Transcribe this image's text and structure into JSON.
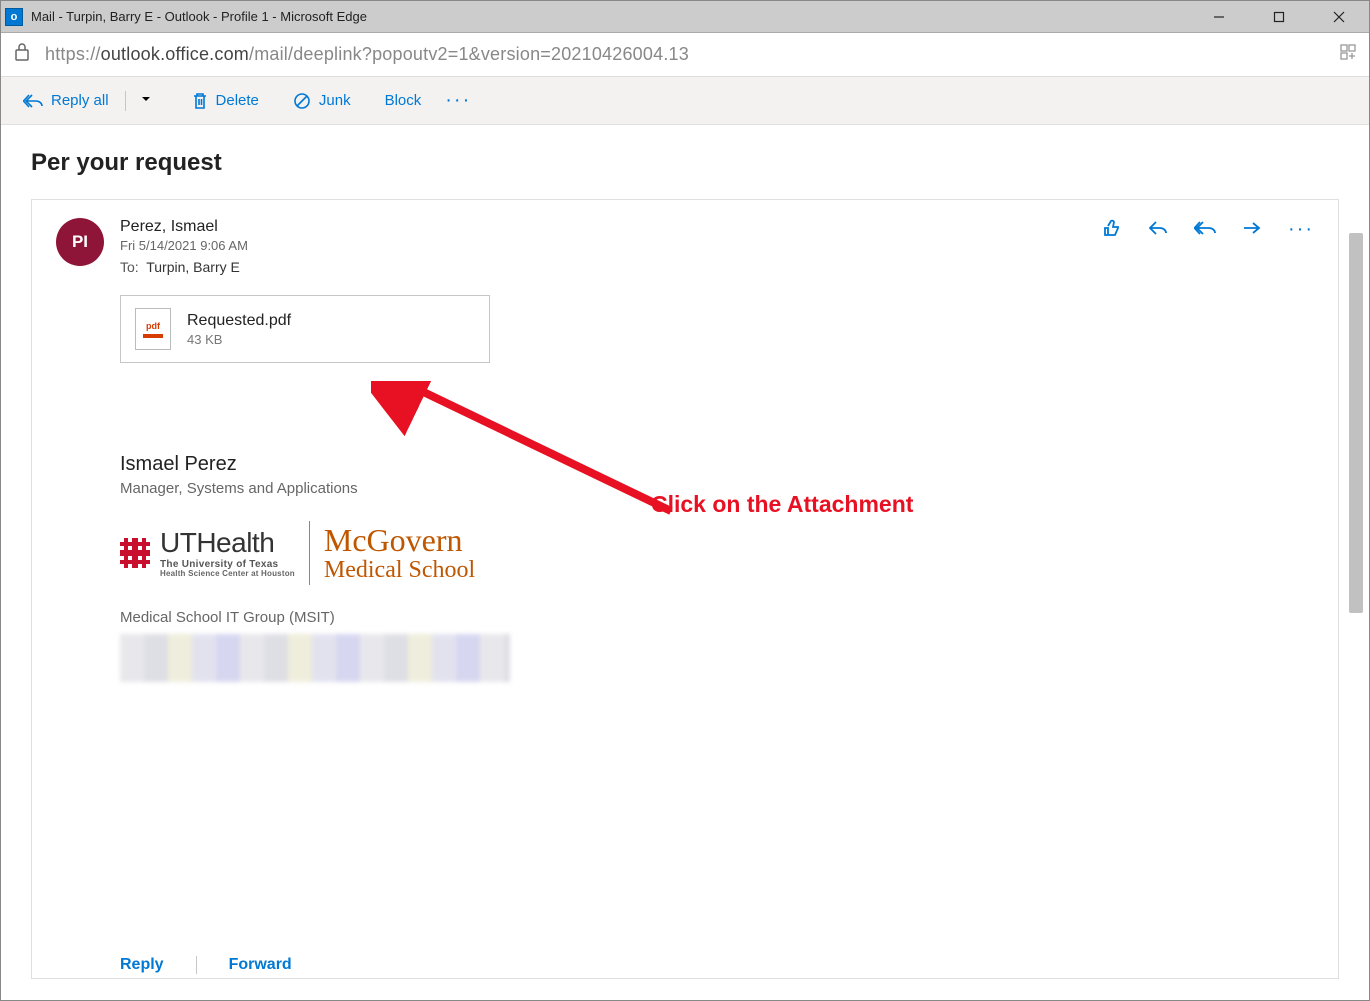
{
  "window": {
    "title": "Mail - Turpin, Barry E - Outlook - Profile 1 - Microsoft Edge",
    "app_icon_label": "o"
  },
  "addressbar": {
    "url_host": "outlook.office.com",
    "url_prefix": "https://",
    "url_path": "/mail/deeplink?popoutv2=1&version=20210426004.13"
  },
  "toolbar": {
    "reply_all": "Reply all",
    "delete": "Delete",
    "junk": "Junk",
    "block": "Block"
  },
  "subject": "Per your request",
  "sender": {
    "initials": "PI",
    "name": "Perez, Ismael",
    "date": "Fri 5/14/2021 9:06 AM",
    "to_label": "To:",
    "to_name": "Turpin, Barry E"
  },
  "attachment": {
    "icon_label": "pdf",
    "filename": "Requested.pdf",
    "size": "43 KB"
  },
  "signature": {
    "name": "Ismael Perez",
    "title": "Manager, Systems and Applications",
    "uthealth": "UTHealth",
    "sub1": "The University of Texas",
    "sub2": "Health Science Center at Houston",
    "mcgovern1": "McGovern",
    "mcgovern2": "Medical School",
    "group": "Medical School IT Group (MSIT)"
  },
  "footer": {
    "reply": "Reply",
    "forward": "Forward"
  },
  "annotation": {
    "text": "Click on the Attachment"
  }
}
